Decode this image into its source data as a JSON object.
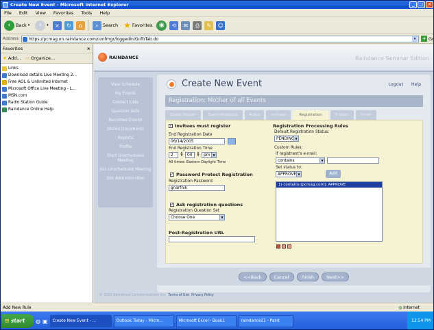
{
  "window": {
    "title": "Create New Event - Microsoft Internet Explorer"
  },
  "menu": [
    "File",
    "Edit",
    "View",
    "Favorites",
    "Tools",
    "Help"
  ],
  "toolbar": {
    "back": "Back",
    "search": "Search",
    "favorites": "Favorites"
  },
  "address": {
    "label": "Address",
    "url": "https://pcmag.on.raindance.com/confmgr/loggedin/GoToTab.do",
    "go": "Go"
  },
  "favorites": {
    "title": "Favorites",
    "add": "Add...",
    "organize": "Organize...",
    "items": [
      {
        "label": "Links",
        "color": "#e8c44a"
      },
      {
        "label": "Download details Live Meeting 2...",
        "color": "#3a7bd5"
      },
      {
        "label": "Free AOL & Unlimited Internet",
        "color": "#e5b000"
      },
      {
        "label": "Microsoft Office Live Meeting - L...",
        "color": "#3a7bd5"
      },
      {
        "label": "MSN.com",
        "color": "#3a7bd5"
      },
      {
        "label": "Radio Station Guide",
        "color": "#3a7bd5"
      },
      {
        "label": "Raindance Online Help",
        "color": "#2e8b57"
      }
    ]
  },
  "app": {
    "logo": "RAINDANCE",
    "edition": "Raindance Seminar Edition",
    "nav": [
      "View Schedule",
      "My Events",
      "Contact Lists",
      "Question Sets",
      "Recorded Events",
      "Stored Documents",
      "Reports",
      "Profile",
      "Start Unscheduled Meeting",
      "Join Unscheduled Meeting",
      "Site Administration"
    ],
    "page_title": "Create New Event",
    "logout": "Logout",
    "help": "Help",
    "registration_bar": "Registration: Mother of all Events",
    "tabs": [
      "Event Details",
      "Event Materials",
      "Audio",
      "Invitees",
      "Registration",
      "E-mails",
      "Finish"
    ],
    "active_tab": "Registration",
    "form": {
      "invitees_must_register": "Invitees must register",
      "end_reg_date_label": "End Registration Date",
      "end_reg_date": "06/14/2005",
      "end_reg_time_label": "End Registration Time",
      "hour": "2",
      "minute": "00",
      "ampm": "pm",
      "timezone_note": "All times: Eastern Daylight Time",
      "password_protect": "Password Protect Registration",
      "reg_password_label": "Registration Password",
      "reg_password": "gnarfnik",
      "ask_questions": "Ask registration questions",
      "question_set_label": "Registration Question Set",
      "question_set": "Choose One",
      "post_reg_url_label": "Post-Registration URL",
      "post_reg_url": ""
    },
    "rules": {
      "title": "Registration Processing Rules",
      "default_status_label": "Default Registration Status:",
      "default_status": "PENDING",
      "custom_rules_label": "Custom Rules:",
      "if_email_label": "If registrant's e-mail:",
      "condition": "contains",
      "condition_value": "",
      "set_status_label": "Set status to:",
      "set_status": "APPROVE",
      "add_button": "Add",
      "rule_list": [
        "1) contains [pcmag.com]: APPROVE"
      ]
    },
    "buttons": {
      "back": "<<Back",
      "cancel": "Cancel",
      "finish": "Finish",
      "next": "Next>>"
    },
    "copyright": "© 2005 Raindance Communications Inc.",
    "terms": "Terms of Use",
    "privacy": "Privacy Policy"
  },
  "status": {
    "text": "Add New Rule",
    "zone": "Internet"
  },
  "taskbar": {
    "start": "start",
    "tasks": [
      "Create New Event - ...",
      "Outlook Today - Micro...",
      "Microsoft Excel - Book1",
      "raindance21 - Paint"
    ],
    "clock": "12:54 PM"
  }
}
